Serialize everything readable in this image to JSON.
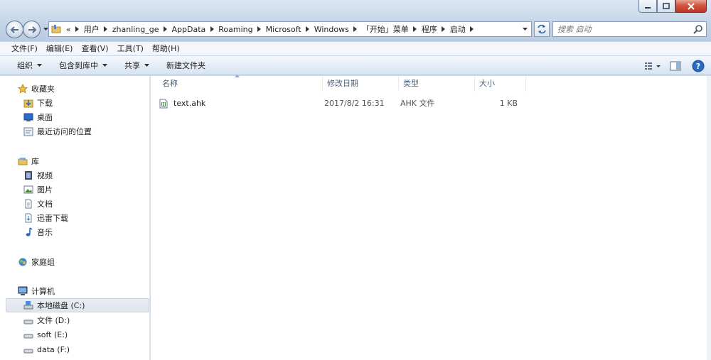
{
  "window": {
    "controls": {
      "minimize": "minimize",
      "maximize": "maximize",
      "close": "close"
    }
  },
  "address": {
    "overflow": "«",
    "crumbs": [
      "用户",
      "zhanling_ge",
      "AppData",
      "Roaming",
      "Microsoft",
      "Windows",
      "「开始」菜单",
      "程序",
      "启动"
    ]
  },
  "search": {
    "placeholder": "搜索 启动"
  },
  "menu": [
    "文件(F)",
    "编辑(E)",
    "查看(V)",
    "工具(T)",
    "帮助(H)"
  ],
  "toolbar": {
    "organize": "组织",
    "include_library": "包含到库中",
    "share": "共享",
    "new_folder": "新建文件夹"
  },
  "sidebar": {
    "favorites": {
      "label": "收藏夹",
      "items": [
        "下载",
        "桌面",
        "最近访问的位置"
      ]
    },
    "libraries": {
      "label": "库",
      "items": [
        "视频",
        "图片",
        "文档",
        "迅雷下载",
        "音乐"
      ]
    },
    "homegroup": {
      "label": "家庭组"
    },
    "computer": {
      "label": "计算机",
      "items": [
        "本地磁盘 (C:)",
        "文件 (D:)",
        "soft (E:)",
        "data (F:)"
      ]
    }
  },
  "columns": {
    "name": "名称",
    "modified": "修改日期",
    "type": "类型",
    "size": "大小"
  },
  "files": [
    {
      "name": "text.ahk",
      "modified": "2017/8/2 16:31",
      "type": "AHK 文件",
      "size": "1 KB"
    }
  ],
  "colors": {
    "accent": "#3a6ea5",
    "selection": "#dfe5ec"
  }
}
